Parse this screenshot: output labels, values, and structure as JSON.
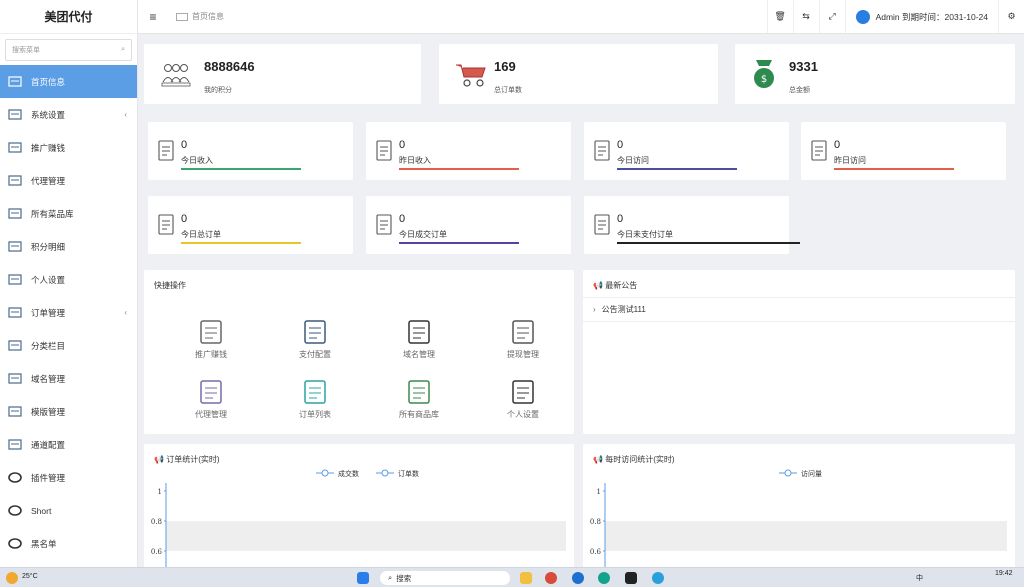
{
  "app": {
    "title": "美团代付"
  },
  "sidebar": {
    "search_placeholder": "搜索菜单",
    "items": [
      {
        "label": "首页信息",
        "active": true,
        "chevron": false
      },
      {
        "label": "系统设置",
        "active": false,
        "chevron": true
      },
      {
        "label": "推广赚钱",
        "active": false,
        "chevron": false
      },
      {
        "label": "代理管理",
        "active": false,
        "chevron": false
      },
      {
        "label": "所有菜品库",
        "active": false,
        "chevron": false
      },
      {
        "label": "积分明细",
        "active": false,
        "chevron": false
      },
      {
        "label": "个人设置",
        "active": false,
        "chevron": false
      },
      {
        "label": "订单管理",
        "active": false,
        "chevron": true
      },
      {
        "label": "分类栏目",
        "active": false,
        "chevron": false
      },
      {
        "label": "域名管理",
        "active": false,
        "chevron": false
      },
      {
        "label": "模版管理",
        "active": false,
        "chevron": false
      },
      {
        "label": "通道配置",
        "active": false,
        "chevron": false
      },
      {
        "label": "插件管理",
        "active": false,
        "chevron": false
      },
      {
        "label": "Short",
        "active": false,
        "chevron": false
      },
      {
        "label": "黑名单",
        "active": false,
        "chevron": false
      }
    ]
  },
  "topbar": {
    "breadcrumb": "首页信息",
    "user_text": "Admin 到期时间：2031-10-24"
  },
  "stats_big": [
    {
      "value": "8888646",
      "label": "我的积分"
    },
    {
      "value": "169",
      "label": "总订单数"
    },
    {
      "value": "9331",
      "label": "总金额"
    }
  ],
  "stats_small": [
    {
      "value": "0",
      "label": "今日收入",
      "color": "#3aa66b"
    },
    {
      "value": "0",
      "label": "昨日收入",
      "color": "#e2604a"
    },
    {
      "value": "0",
      "label": "今日访问",
      "color": "#4a4f9e"
    },
    {
      "value": "0",
      "label": "昨日访问",
      "color": "#e2604a"
    },
    {
      "value": "0",
      "label": "今日总订单",
      "color": "#e8c52a"
    },
    {
      "value": "0",
      "label": "今日成交订单",
      "color": "#5a3fa5"
    },
    {
      "value": "0",
      "label": "今日未支付订单",
      "color": "#222222"
    }
  ],
  "quick": {
    "title": "快捷操作",
    "items": [
      "推广赚钱",
      "支付配置",
      "域名管理",
      "提现管理",
      "代理管理",
      "订单列表",
      "所有商品库",
      "个人设置"
    ]
  },
  "notice": {
    "title": "最新公告",
    "items": [
      "公告测试111"
    ]
  },
  "order_chart": {
    "title": "订单统计(实时)",
    "chart_data": {
      "type": "line",
      "series": [
        {
          "name": "成交数",
          "values": []
        },
        {
          "name": "订单数",
          "values": []
        }
      ],
      "yticks": [
        "1",
        "0.8",
        "0.6"
      ]
    }
  },
  "visit_chart": {
    "title": "每时访问统计(实时)",
    "chart_data": {
      "type": "line",
      "series": [
        {
          "name": "访问量",
          "values": []
        }
      ],
      "yticks": [
        "1",
        "0.8",
        "0.6"
      ]
    }
  },
  "taskbar": {
    "weather": "25°C",
    "search": "搜索",
    "ime": "中",
    "time": "19:42"
  }
}
